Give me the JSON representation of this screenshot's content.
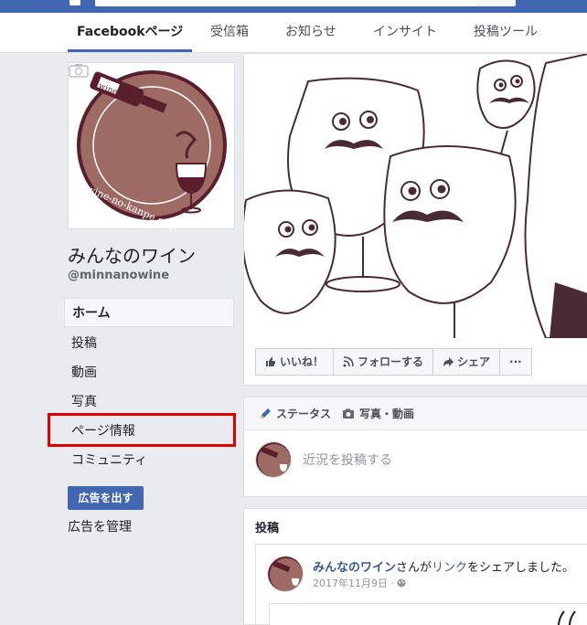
{
  "tabs": [
    {
      "label": "Facebookページ"
    },
    {
      "label": "受信箱"
    },
    {
      "label": "お知らせ"
    },
    {
      "label": "インサイト"
    },
    {
      "label": "投稿ツール"
    }
  ],
  "profile": {
    "name": "みんなのワイン",
    "handle": "@minnanowine",
    "logo_text": "wine-no-kanpe.com",
    "logo_small": "wine"
  },
  "nav": [
    {
      "label": "ホーム"
    },
    {
      "label": "投稿"
    },
    {
      "label": "動画"
    },
    {
      "label": "写真"
    },
    {
      "label": "ページ情報"
    },
    {
      "label": "コミュニティ"
    }
  ],
  "ads": {
    "button": "広告を出す",
    "manage": "広告を管理"
  },
  "actions": {
    "like": "いいね！",
    "follow": "フォローする",
    "share": "シェア",
    "more": "···"
  },
  "composer": {
    "status_tab": "ステータス",
    "photo_tab": "写真・動画",
    "placeholder": "近況を投稿する"
  },
  "posts": {
    "title": "投稿",
    "author": "みんなのワイン",
    "text_mid": "さんが",
    "link_label": "リンク",
    "text_end": "をシェアしました。",
    "date": "2017年11月9日 ·"
  },
  "colors": {
    "brand_blue": "#4267b2",
    "highlight_red": "#e00000",
    "wine": "#9d6a64"
  }
}
